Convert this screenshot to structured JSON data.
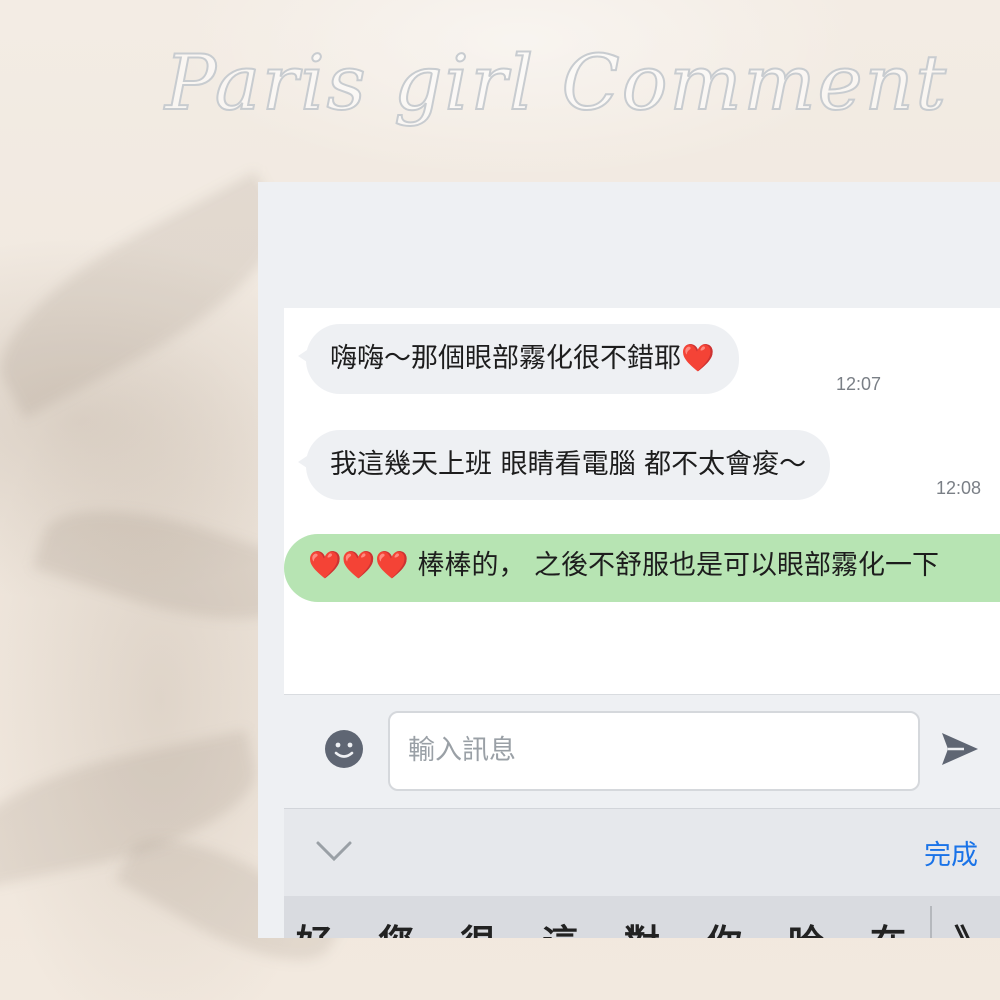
{
  "header": {
    "title": "Paris girl Comment"
  },
  "messages": [
    {
      "side": "in",
      "text": "嗨嗨～那個眼部霧化很不錯耶",
      "emoji": "❤️",
      "time": "12:07"
    },
    {
      "side": "in",
      "text": "我這幾天上班 眼睛看電腦 都不太會痠～",
      "time": "12:08"
    },
    {
      "side": "out",
      "emoji": "❤️❤️❤️",
      "text": "棒棒的， 之後不舒服也是可以眼部霧化一下"
    }
  ],
  "input": {
    "placeholder": "輸入訊息",
    "emoji_icon": "smile-icon",
    "send_icon": "send-icon"
  },
  "keyboard": {
    "collapse_icon": "chevron-down-icon",
    "done_label": "完成",
    "candidates": [
      "好",
      "您",
      "很",
      "這",
      "對",
      "你",
      "哈",
      "在",
      "》"
    ]
  },
  "colors": {
    "outgoing_bubble": "#b7e4b3",
    "incoming_bubble": "#eef0f3",
    "accent": "#1a73e8"
  }
}
